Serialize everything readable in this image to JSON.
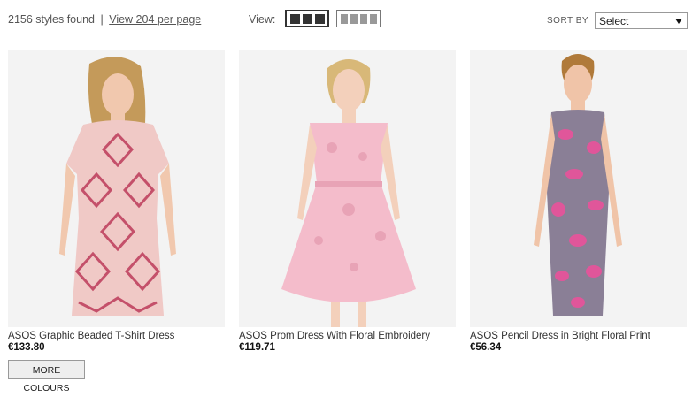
{
  "results": {
    "count_text": "2156 styles found",
    "separator": "|",
    "per_page_link": "View 204 per page"
  },
  "view": {
    "label": "View:"
  },
  "sort": {
    "label": "SORT BY",
    "selected": "Select"
  },
  "products": [
    {
      "name": "ASOS Graphic Beaded T-Shirt Dress",
      "price": "€133.80",
      "more_colours": "MORE COLOURS",
      "colors": {
        "dress": "#f0c9c6",
        "pattern": "#c4506a",
        "hair": "#c49a5a",
        "skin": "#f1c8ae"
      }
    },
    {
      "name": "ASOS Prom Dress With Floral Embroidery",
      "price": "€119.71",
      "colors": {
        "dress": "#f4bccb",
        "pattern": "#e8a3b6",
        "hair": "#d8b878",
        "skin": "#f3d0bb"
      }
    },
    {
      "name": "ASOS Pencil Dress in Bright Floral Print",
      "price": "€56.34",
      "colors": {
        "dress": "#8a7f96",
        "pattern": "#e0569a",
        "hair": "#b07a3a",
        "skin": "#f0c4a8"
      }
    }
  ]
}
